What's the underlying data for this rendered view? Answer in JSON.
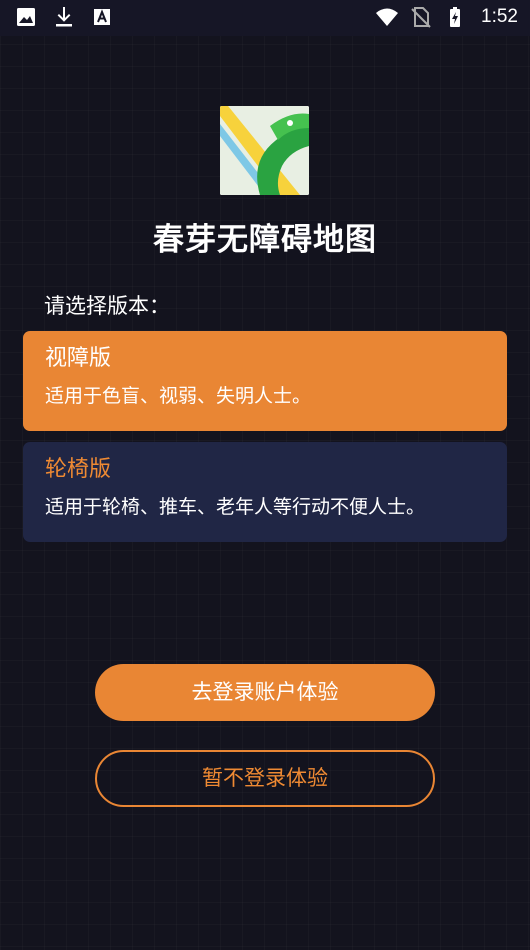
{
  "status_bar": {
    "left_icons": [
      "image-icon",
      "download-icon",
      "font-a-icon"
    ],
    "right_icons": [
      "wifi-icon",
      "no-sim-icon",
      "battery-charging-icon"
    ],
    "time": "1:52"
  },
  "app": {
    "logo_icon": "chunya-leaf-map-logo",
    "title": "春芽无障碍地图"
  },
  "prompt": "请选择版本：",
  "versions": [
    {
      "title": "视障版",
      "description": "适用于色盲、视弱、失明人士。",
      "selected": true
    },
    {
      "title": "轮椅版",
      "description": "适用于轮椅、推车、老年人等行动不便人士。",
      "selected": false
    }
  ],
  "buttons": {
    "login": "去登录账户体验",
    "skip": "暂不登录体验"
  },
  "colors": {
    "accent": "#e98634",
    "background": "#13131e",
    "card_unselected": "#202645"
  }
}
